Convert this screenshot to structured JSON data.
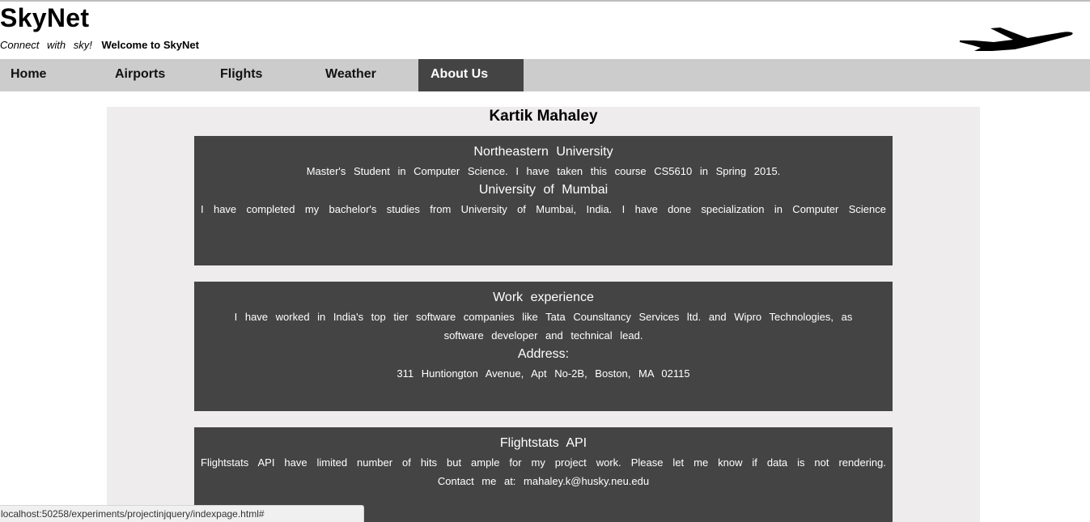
{
  "header": {
    "brand": "SkyNet",
    "tagline": "Connect with sky!",
    "welcome": "Welcome to SkyNet",
    "logo_icon": "airplane-icon"
  },
  "nav": {
    "items": [
      {
        "label": "Home"
      },
      {
        "label": "Airports"
      },
      {
        "label": "Flights"
      },
      {
        "label": "Weather"
      },
      {
        "label": "About Us",
        "active": true
      }
    ]
  },
  "about": {
    "name": "Kartik Mahaley",
    "education": {
      "school1": "Northeastern University",
      "school1_text": "Master's Student in Computer Science. I have taken this course CS5610 in Spring 2015.",
      "school2": "University of Mumbai",
      "school2_text": "I have completed my bachelor's studies from University of Mumbai, India. I have done specialization in Computer Science"
    },
    "work": {
      "title": "Work experience",
      "text": "I have worked in India's top tier software companies like Tata Counsltancy Services ltd. and Wipro Technologies, as software developer and technical lead.",
      "address_title": "Address:",
      "address": "311 Huntiongton Avenue, Apt No-2B, Boston, MA 02115"
    },
    "api": {
      "title": "Flightstats API",
      "text": "Flightstats API have limited number of hits but ample for my project work. Please let me know if data is not rendering.",
      "contact": "Contact me at: mahaley.k@husky.neu.edu"
    }
  },
  "status": {
    "url": "localhost:50258/experiments/projectinjquery/indexpage.html#"
  },
  "colors": {
    "nav_bg": "#cccccc",
    "active_tab": "#444444",
    "card_bg": "#444444",
    "panel_bg": "#eeecec"
  }
}
